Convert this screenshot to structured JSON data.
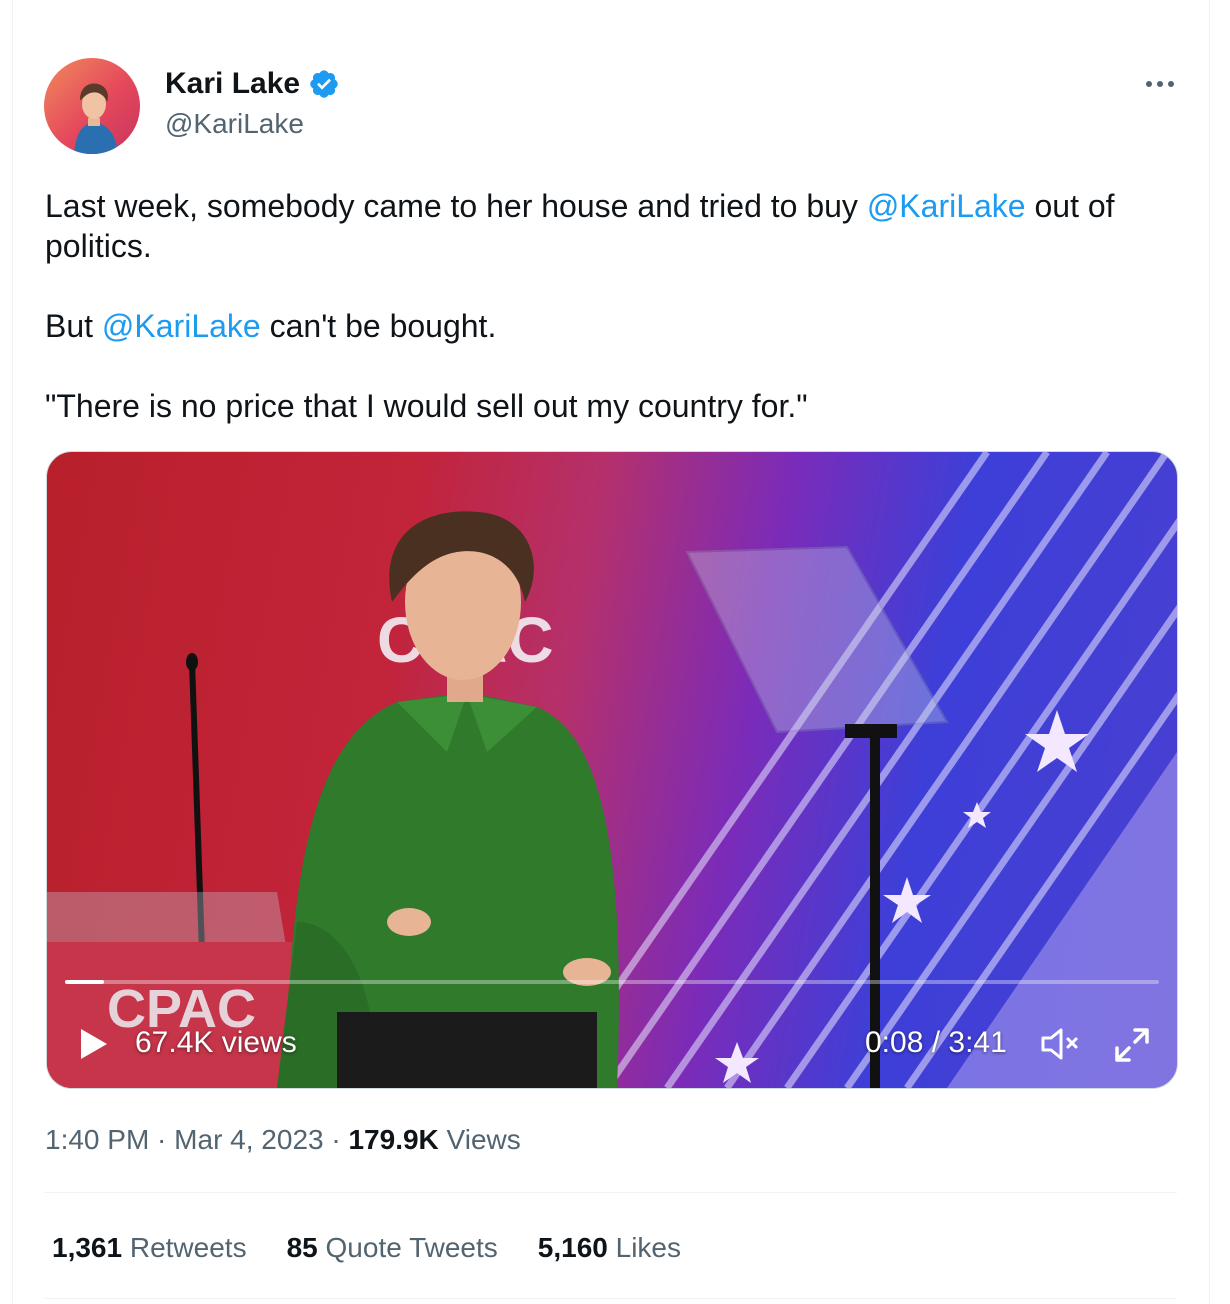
{
  "author": {
    "name": "Kari Lake",
    "handle": "@KariLake"
  },
  "tweet": {
    "line1_before": "Last week, somebody came to her house and tried to buy ",
    "line1_mention": "@KariLake",
    "line1_after": " out of politics.",
    "line2_before": "But ",
    "line2_mention": "@KariLake",
    "line2_after": " can't be bought.",
    "line3": "\"There is no price that I would sell out my country for.\""
  },
  "video": {
    "views_label": "67.4K views",
    "time_label": "0:08 / 3:41",
    "progress_fraction": 0.036,
    "stage_text": "CPAC",
    "muted": true
  },
  "meta": {
    "time": "1:40 PM",
    "separator": " · ",
    "date": "Mar 4, 2023",
    "views_count": "179.9K",
    "views_label": " Views"
  },
  "stats": {
    "retweets_count": "1,361",
    "retweets_label": " Retweets",
    "quotes_count": "85",
    "quotes_label": " Quote Tweets",
    "likes_count": "5,160",
    "likes_label": " Likes"
  },
  "colors": {
    "accent": "#1d9bf0",
    "secondary_text": "#536471",
    "primary_text": "#0f1419",
    "blouse": "#2f7a2b"
  },
  "icons": [
    "verified-badge-icon",
    "more-options-icon",
    "play-icon",
    "mute-icon",
    "fullscreen-icon"
  ]
}
